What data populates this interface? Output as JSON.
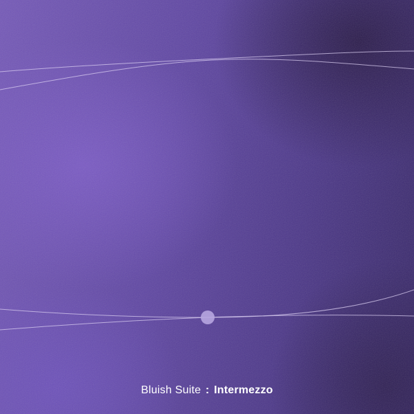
{
  "cover": {
    "series": "Bluish Suite",
    "separator": ":",
    "title": "Intermezzo"
  },
  "colors": {
    "background_light": "#7458b8",
    "background_dark": "#372768",
    "line": "#d9cdf0",
    "dot": "#b7a6e0",
    "text": "#ffffff"
  }
}
